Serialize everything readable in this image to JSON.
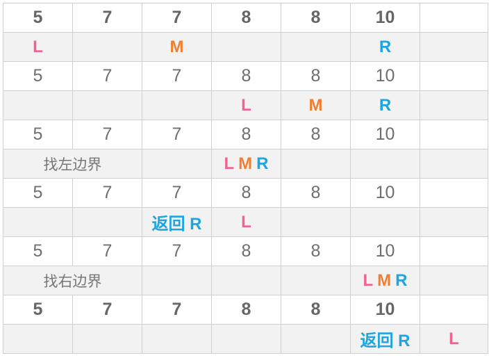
{
  "colors": {
    "L": "#f06292",
    "M": "#f07f32",
    "R": "#1ea4e0",
    "ret": "#1ea4e0",
    "text": "#6e6e6e",
    "row_bg": "#f2f2f2",
    "border": "#cfcfcf"
  },
  "numbers": [
    "5",
    "7",
    "7",
    "8",
    "8",
    "10"
  ],
  "steps": [
    {
      "bold": true,
      "cells": [
        [
          {
            "t": "L",
            "c": "L"
          }
        ],
        [],
        [
          {
            "t": "M",
            "c": "M"
          }
        ],
        [],
        [],
        [
          {
            "t": "R",
            "c": "R"
          }
        ],
        []
      ]
    },
    {
      "bold": false,
      "cells": [
        [],
        [],
        [],
        [
          {
            "t": "L",
            "c": "L"
          }
        ],
        [
          {
            "t": "M",
            "c": "M"
          }
        ],
        [
          {
            "t": "R",
            "c": "R"
          }
        ],
        []
      ]
    },
    {
      "bold": false,
      "label": "找左边界",
      "cells": [
        [],
        [],
        [],
        [
          {
            "t": "L",
            "c": "L"
          },
          {
            "t": "M",
            "c": "M"
          },
          {
            "t": "R",
            "c": "R"
          }
        ],
        [],
        [],
        []
      ]
    },
    {
      "bold": false,
      "cells": [
        [],
        [],
        [
          {
            "t": "返回 R",
            "c": "ret"
          }
        ],
        [
          {
            "t": "L",
            "c": "L"
          }
        ],
        [],
        [],
        []
      ]
    },
    {
      "bold": false,
      "label": "找右边界",
      "cells": [
        [],
        [],
        [],
        [],
        [],
        [
          {
            "t": "L",
            "c": "L"
          },
          {
            "t": "M",
            "c": "M"
          },
          {
            "t": "R",
            "c": "R"
          }
        ],
        []
      ]
    },
    {
      "bold": true,
      "cells": [
        [],
        [],
        [],
        [],
        [],
        [
          {
            "t": "返回 R",
            "c": "ret"
          }
        ],
        [
          {
            "t": "L",
            "c": "L"
          }
        ]
      ]
    }
  ]
}
